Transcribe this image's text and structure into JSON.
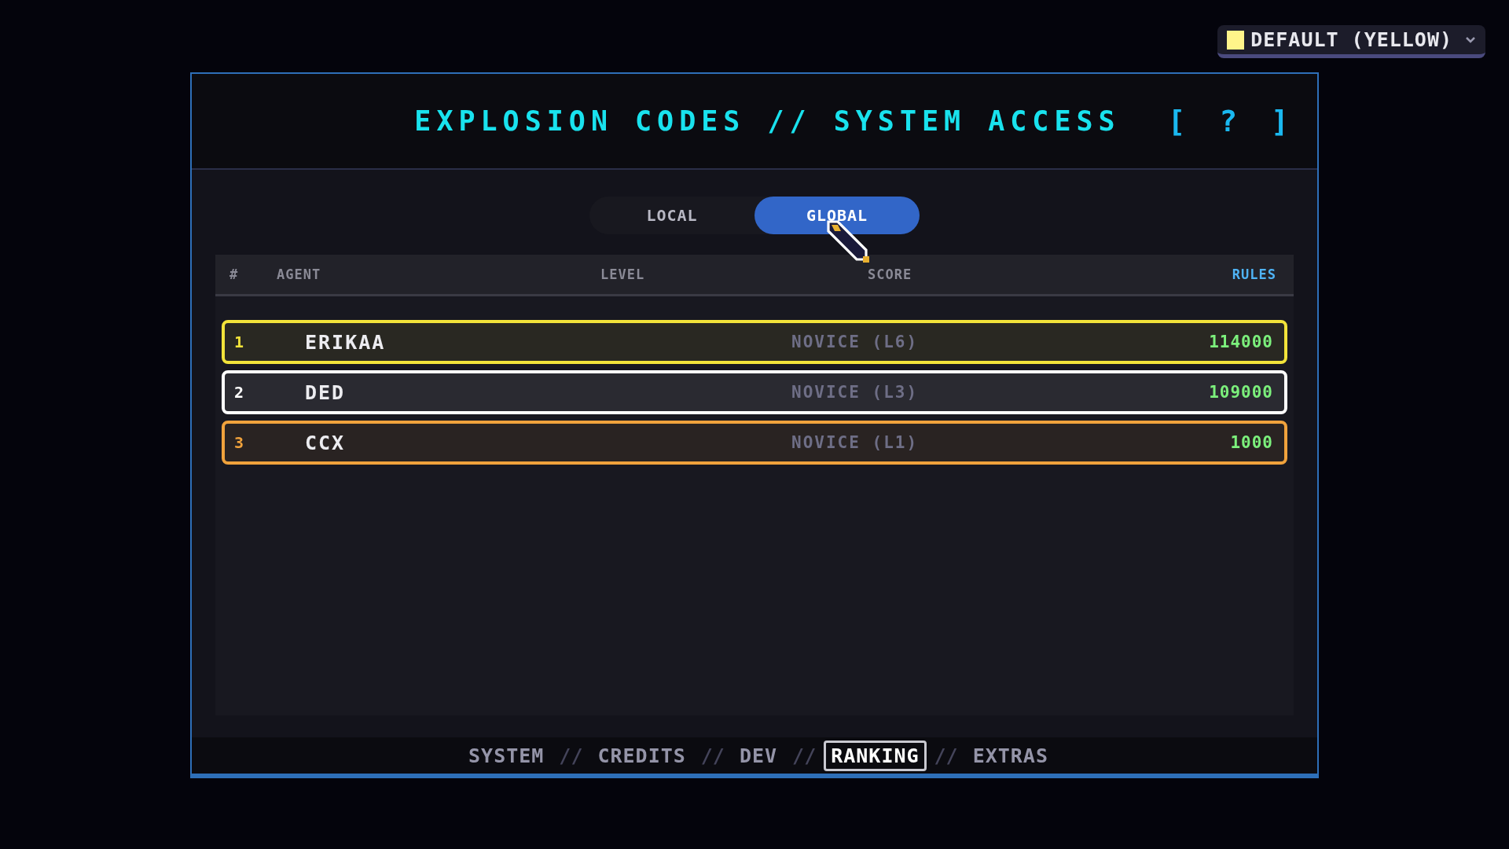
{
  "theme_select": {
    "color": "#fff48a",
    "label": "DEFAULT (YELLOW)"
  },
  "header": {
    "title": "EXPLOSION CODES // SYSTEM ACCESS",
    "help": "[ ? ]"
  },
  "tabs": [
    {
      "label": "LOCAL",
      "selected": false
    },
    {
      "label": "GLOBAL",
      "selected": true
    }
  ],
  "table": {
    "columns": [
      "#",
      "AGENT",
      "LEVEL",
      "SCORE"
    ],
    "rules_link": "RULES",
    "rows": [
      {
        "rank": "1",
        "agent": "ERIKAA",
        "level": "NOVICE (L6)",
        "score": "114000",
        "color": "#f2e33a"
      },
      {
        "rank": "2",
        "agent": "DED",
        "level": "NOVICE (L3)",
        "score": "109000",
        "color": "#ffffff"
      },
      {
        "rank": "3",
        "agent": "CCX",
        "level": "NOVICE (L1)",
        "score": "1000",
        "color": "#f0a23c"
      }
    ]
  },
  "footer_nav": [
    {
      "kind": "link",
      "label": "SYSTEM",
      "selected": false
    },
    {
      "kind": "separator",
      "label": "//"
    },
    {
      "kind": "link",
      "label": "CREDITS",
      "selected": false
    },
    {
      "kind": "separator",
      "label": "//"
    },
    {
      "kind": "link",
      "label": "DEV",
      "selected": false
    },
    {
      "kind": "separator",
      "label": "//"
    },
    {
      "kind": "link",
      "label": "RANKING",
      "selected": true
    },
    {
      "kind": "separator",
      "label": "//"
    },
    {
      "kind": "link",
      "label": "EXTRAS",
      "selected": false
    }
  ]
}
